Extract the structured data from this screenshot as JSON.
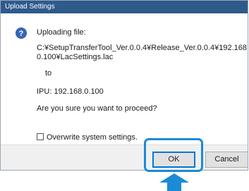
{
  "dialog": {
    "title": "Upload Settings",
    "icon": "question-icon",
    "heading": "Uploading file:",
    "path_line1": "C:¥SetupTransferTool_Ver.0.0.4¥Release_Ver.0.0.4¥192.168.",
    "path_line2": "0.100¥LacSettings.lac",
    "to_label": "to",
    "ipu_line": "IPU: 192.168.0.100",
    "confirm_text": "Are you sure you want to proceed?",
    "checkbox_label": "Overwrite system settings.",
    "checkbox_checked": false,
    "ok_label": "OK",
    "cancel_label": "Cancel"
  },
  "annotation": {
    "highlight_target": "OK",
    "highlight_color": "#1c8ad6",
    "pointer_icon": "up-arrow-icon"
  },
  "colors": {
    "titlebar": "#2e5a8c",
    "icon": "#2a5aa8",
    "footer": "#f0f0f0"
  }
}
